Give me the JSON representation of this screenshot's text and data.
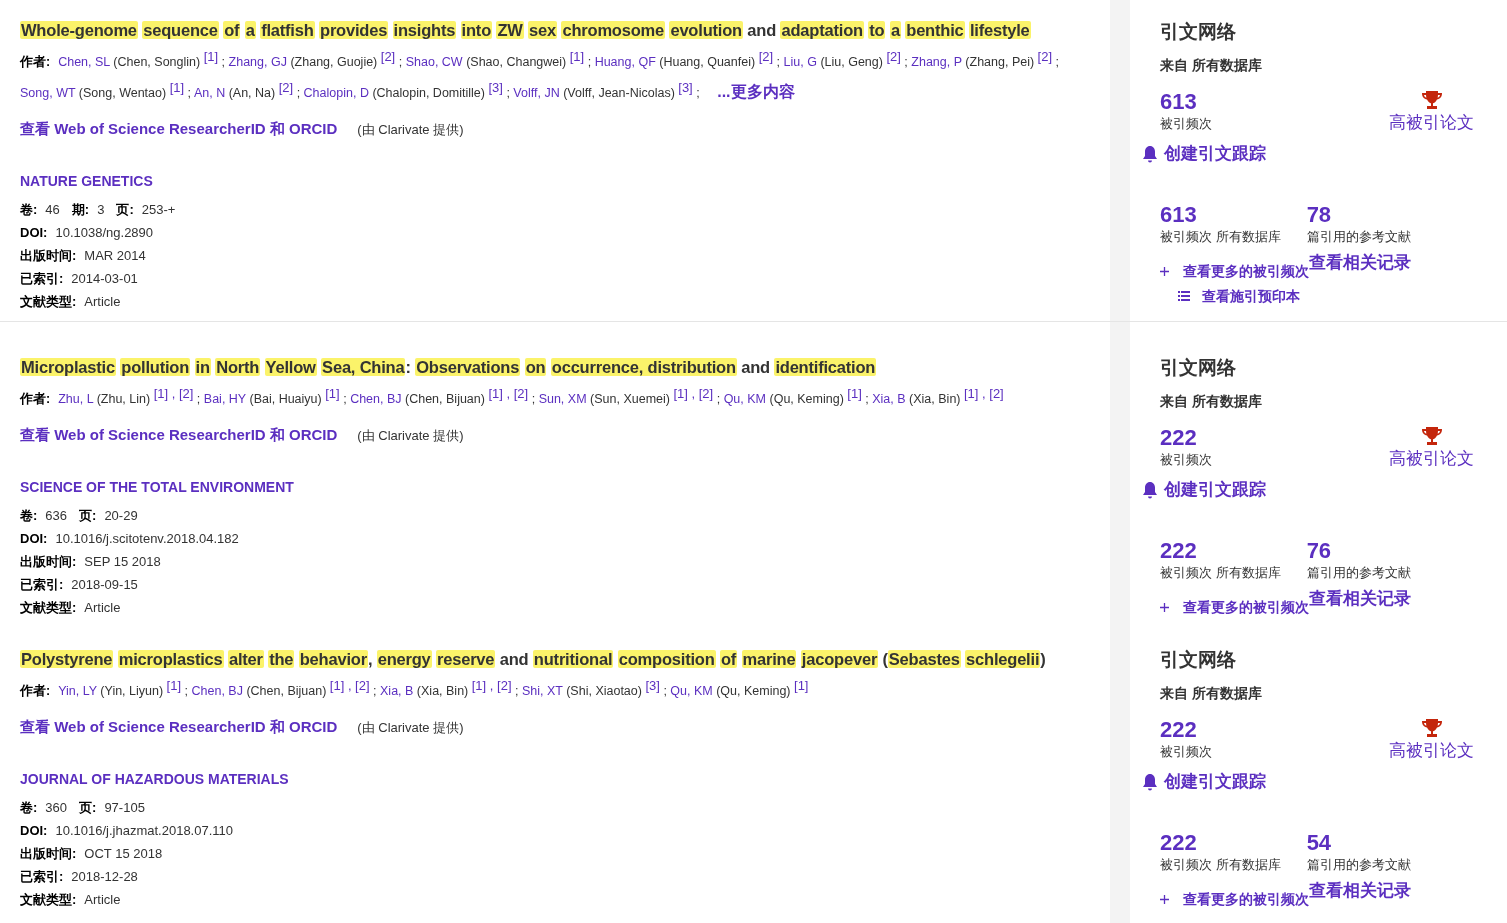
{
  "records": [
    {
      "title": [
        {
          "text": "Whole-genome",
          "highlighted": true
        },
        {
          "text": "sequence",
          "highlighted": true
        },
        {
          "text": "of",
          "highlighted": true
        },
        {
          "text": "a",
          "highlighted": true
        },
        {
          "text": "flatfish",
          "highlighted": true
        },
        {
          "text": "provides",
          "highlighted": true
        },
        {
          "text": "insights",
          "highlighted": true
        },
        {
          "text": "into",
          "highlighted": true
        },
        {
          "text": "ZW",
          "highlighted": true
        },
        {
          "text": "sex",
          "highlighted": true
        },
        {
          "text": "chromosome",
          "highlighted": true
        },
        {
          "text": "evolution",
          "highlighted": true
        },
        {
          "text": "and",
          "highlighted": false
        },
        {
          "text": "adaptation",
          "highlighted": true
        },
        {
          "text": "to",
          "highlighted": true
        },
        {
          "text": "a",
          "highlighted": true
        },
        {
          "text": "benthic",
          "highlighted": true
        },
        {
          "text": "lifestyle",
          "highlighted": true
        }
      ],
      "authors_label": "作者:",
      "authors": [
        {
          "name": "Chen, SL",
          "full": "(Chen, Songlin)",
          "refs": "[1]",
          "sep": ";"
        },
        {
          "name": "Zhang, GJ",
          "full": "(Zhang, Guojie)",
          "refs": "[2]",
          "sep": ";"
        },
        {
          "name": "Shao, CW",
          "full": "(Shao, Changwei)",
          "refs": "[1]",
          "sep": ";"
        },
        {
          "name": "Huang, QF",
          "full": "(Huang, Quanfei)",
          "refs": "[2]",
          "sep": ";"
        },
        {
          "name": "Liu, G",
          "full": "(Liu, Geng)",
          "refs": "[2]",
          "sep": ";"
        },
        {
          "name": "Zhang, P",
          "full": "(Zhang, Pei)",
          "refs": "[2]",
          "sep": ";"
        },
        {
          "name": "Song, WT",
          "full": "(Song, Wentao)",
          "refs": "[1]",
          "sep": ";"
        },
        {
          "name": "An, N",
          "full": "(An, Na)",
          "refs": "[2]",
          "sep": ";"
        },
        {
          "name": "Chalopin, D",
          "full": "(Chalopin, Domitille)",
          "refs": "[3]",
          "sep": ";"
        },
        {
          "name": "Volff, JN",
          "full": "(Volff, Jean-Nicolas)",
          "refs": "[3]",
          "sep": ";"
        }
      ],
      "more_link": "...更多内容",
      "researcher_link": "查看 Web of Science ResearcherID 和 ORCID",
      "provider": "(由 Clarivate 提供)",
      "journal": "NATURE GENETICS",
      "fields": [
        [
          {
            "label": "卷:",
            "value": "46"
          },
          {
            "label": "期:",
            "value": "3"
          },
          {
            "label": "页:",
            "value": "253-+"
          }
        ],
        [
          {
            "label": "DOI:",
            "value": "10.1038/ng.2890"
          }
        ],
        [
          {
            "label": "出版时间:",
            "value": "MAR 2014"
          }
        ],
        [
          {
            "label": "已索引:",
            "value": "2014-03-01"
          }
        ],
        [
          {
            "label": "文献类型:",
            "value": "Article"
          }
        ]
      ],
      "citations": {
        "title": "引文网络",
        "source": "来自 所有数据库",
        "count": "613",
        "count_label": "被引频次",
        "badge": "高被引论文",
        "alert": "创建引文跟踪",
        "stats": [
          {
            "value": "613",
            "label": "被引频次 所有数据库"
          },
          {
            "value": "78",
            "label": "篇引用的参考文献"
          }
        ],
        "more_citations": "查看更多的被引频次",
        "related": "查看相关记录",
        "preprints": "查看施引预印本"
      }
    },
    {
      "title": [
        {
          "text": "Microplastic",
          "highlighted": true
        },
        {
          "text": "pollution",
          "highlighted": true
        },
        {
          "text": "in",
          "highlighted": true
        },
        {
          "text": "North",
          "highlighted": true
        },
        {
          "text": "Yellow",
          "highlighted": true
        },
        {
          "text": "Sea, China",
          "highlighted": true
        },
        {
          "text": ":",
          "highlighted": false,
          "attach": true
        },
        {
          "text": "Observations",
          "highlighted": true
        },
        {
          "text": "on",
          "highlighted": true
        },
        {
          "text": "occurrence, distribution",
          "highlighted": true
        },
        {
          "text": "and",
          "highlighted": false
        },
        {
          "text": "identification",
          "highlighted": true
        }
      ],
      "authors_label": "作者:",
      "authors": [
        {
          "name": "Zhu, L",
          "full": "(Zhu, Lin)",
          "refs": "[1] , [2]",
          "sep": ";"
        },
        {
          "name": "Bai, HY",
          "full": "(Bai, Huaiyu)",
          "refs": "[1]",
          "sep": ";"
        },
        {
          "name": "Chen, BJ",
          "full": "(Chen, Bijuan)",
          "refs": "[1] , [2]",
          "sep": ";"
        },
        {
          "name": "Sun, XM",
          "full": "(Sun, Xuemei)",
          "refs": "[1] , [2]",
          "sep": ";"
        },
        {
          "name": "Qu, KM",
          "full": "(Qu, Keming)",
          "refs": "[1]",
          "sep": ";"
        },
        {
          "name": "Xia, B",
          "full": "(Xia, Bin)",
          "refs": "[1] , [2]"
        }
      ],
      "researcher_link": "查看 Web of Science ResearcherID 和 ORCID",
      "provider": "(由 Clarivate 提供)",
      "journal": "SCIENCE OF THE TOTAL ENVIRONMENT",
      "fields": [
        [
          {
            "label": "卷:",
            "value": "636"
          },
          {
            "label": "页:",
            "value": "20-29"
          }
        ],
        [
          {
            "label": "DOI:",
            "value": "10.1016/j.scitotenv.2018.04.182"
          }
        ],
        [
          {
            "label": "出版时间:",
            "value": "SEP 15 2018"
          }
        ],
        [
          {
            "label": "已索引:",
            "value": "2018-09-15"
          }
        ],
        [
          {
            "label": "文献类型:",
            "value": "Article"
          }
        ]
      ],
      "citations": {
        "title": "引文网络",
        "source": "来自 所有数据库",
        "count": "222",
        "count_label": "被引频次",
        "badge": "高被引论文",
        "alert": "创建引文跟踪",
        "stats": [
          {
            "value": "222",
            "label": "被引频次 所有数据库"
          },
          {
            "value": "76",
            "label": "篇引用的参考文献"
          }
        ],
        "more_citations": "查看更多的被引频次",
        "related": "查看相关记录"
      }
    },
    {
      "title": [
        {
          "text": "Polystyrene",
          "highlighted": true
        },
        {
          "text": "microplastics",
          "highlighted": true
        },
        {
          "text": "alter",
          "highlighted": true
        },
        {
          "text": "the",
          "highlighted": true
        },
        {
          "text": "behavior",
          "highlighted": true
        },
        {
          "text": ",",
          "highlighted": false,
          "attach": true
        },
        {
          "text": "energy",
          "highlighted": true
        },
        {
          "text": "reserve",
          "highlighted": true
        },
        {
          "text": "and",
          "highlighted": false
        },
        {
          "text": "nutritional",
          "highlighted": true
        },
        {
          "text": "composition",
          "highlighted": true
        },
        {
          "text": "of",
          "highlighted": true
        },
        {
          "text": "marine",
          "highlighted": true
        },
        {
          "text": "jacopever",
          "highlighted": true
        },
        {
          "text": "(",
          "highlighted": false
        },
        {
          "text": "Sebastes",
          "highlighted": true,
          "attach": true
        },
        {
          "text": "schlegelii",
          "highlighted": true
        },
        {
          "text": ")",
          "highlighted": false,
          "attach": true
        }
      ],
      "authors_label": "作者:",
      "authors": [
        {
          "name": "Yin, LY",
          "full": "(Yin, Liyun)",
          "refs": "[1]",
          "sep": ";"
        },
        {
          "name": "Chen, BJ",
          "full": "(Chen, Bijuan)",
          "refs": "[1] , [2]",
          "sep": ";"
        },
        {
          "name": "Xia, B",
          "full": "(Xia, Bin)",
          "refs": "[1] , [2]",
          "sep": ";"
        },
        {
          "name": "Shi, XT",
          "full": "(Shi, Xiaotao)",
          "refs": "[3]",
          "sep": ";"
        },
        {
          "name": "Qu, KM",
          "full": "(Qu, Keming)",
          "refs": "[1]"
        }
      ],
      "researcher_link": "查看 Web of Science ResearcherID 和 ORCID",
      "provider": "(由 Clarivate 提供)",
      "journal": "JOURNAL OF HAZARDOUS MATERIALS",
      "fields": [
        [
          {
            "label": "卷:",
            "value": "360"
          },
          {
            "label": "页:",
            "value": "97-105"
          }
        ],
        [
          {
            "label": "DOI:",
            "value": "10.1016/j.jhazmat.2018.07.110"
          }
        ],
        [
          {
            "label": "出版时间:",
            "value": "OCT 15 2018"
          }
        ],
        [
          {
            "label": "已索引:",
            "value": "2018-12-28"
          }
        ],
        [
          {
            "label": "文献类型:",
            "value": "Article"
          }
        ]
      ],
      "citations": {
        "title": "引文网络",
        "source": "来自 所有数据库",
        "count": "222",
        "count_label": "被引频次",
        "badge": "高被引论文",
        "alert": "创建引文跟踪",
        "stats": [
          {
            "value": "222",
            "label": "被引频次 所有数据库"
          },
          {
            "value": "54",
            "label": "篇引用的参考文献"
          }
        ],
        "more_citations": "查看更多的被引频次",
        "related": "查看相关记录"
      }
    }
  ]
}
